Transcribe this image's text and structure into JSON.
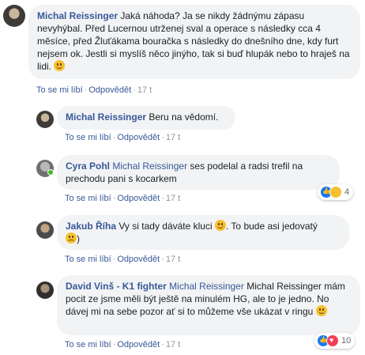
{
  "comments": [
    {
      "author": "Michal Reissinger",
      "text": " Jaká náhoda? Ja se nikdy žádnýmu zápasu nevyhýbal. Před Lucernou utrženej sval a operace s následky cca 4 měsíce, před Žluťákama bouračka s následky do dnešního dne, kdy furt nejsem ok. Jestli si myslíš něco jinýho, tak si buď hlupák nebo to hraješ na lidi.",
      "like": "To se mi líbí",
      "reply": "Odpovědět",
      "time": "17 t"
    },
    {
      "author": "Michal Reissinger",
      "text": " Beru na vědomí.",
      "like": "To se mi líbí",
      "reply": "Odpovědět",
      "time": "17 t"
    },
    {
      "author": "Cyra Pohl",
      "mention": "Michal Reissinger",
      "text": " ses podelal a radsi trefil na prechodu pani s kocarkem",
      "like": "To se mi líbí",
      "reply": "Odpovědět",
      "time": "17 t",
      "reaction_count": "4"
    },
    {
      "author": "Jakub Říha",
      "text_a": " Vy si tady dáváte kluci ",
      "text_b": ". To bude asi jedovatý ",
      "text_c": ")",
      "like": "To se mi líbí",
      "reply": "Odpovědět",
      "time": "17 t"
    },
    {
      "author": "David Vinš - K1 fighter",
      "mention": "Michal Reissinger",
      "text": " Michal Reissinger mám pocit ze jsme měli být ještě na minulém HG, ale to je jedno. No dávej mi na sebe pozor ať si to můžeme vše ukázat v ringu",
      "like": "To se mi líbí",
      "reply": "Odpovědět",
      "time": "17 t",
      "reaction_count": "10"
    }
  ],
  "colors": {
    "link": "#385898",
    "bubble": "#f2f3f5",
    "meta": "#616770"
  }
}
